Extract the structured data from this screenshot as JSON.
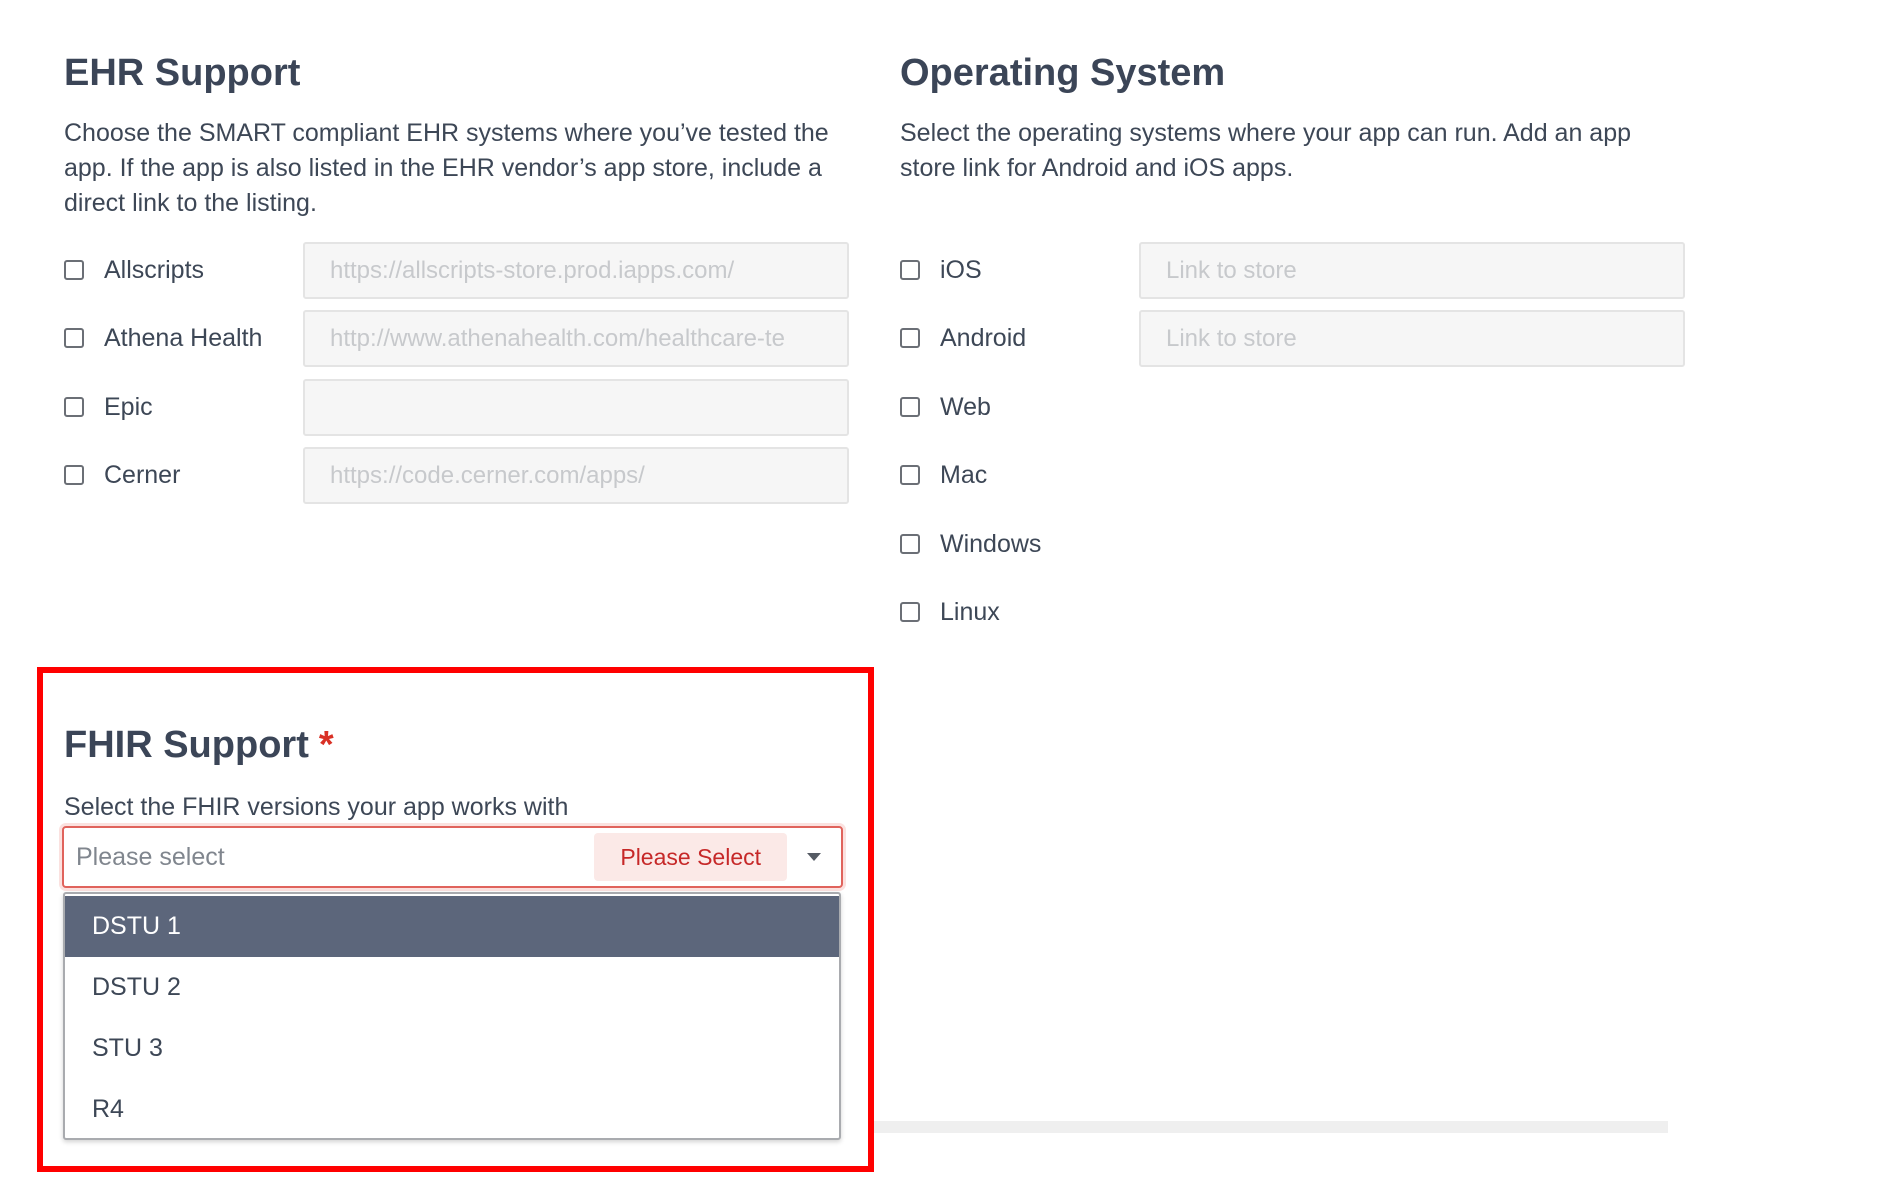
{
  "ehr": {
    "title": "EHR Support",
    "description": "Choose the SMART compliant EHR systems where you’ve tested the app. If the app is also listed in the EHR vendor’s app store, include a direct link to the listing.",
    "items": [
      {
        "label": "Allscripts",
        "placeholder": "https://allscripts-store.prod.iapps.com/"
      },
      {
        "label": "Athena Health",
        "placeholder": "http://www.athenahealth.com/healthcare-te"
      },
      {
        "label": "Epic",
        "placeholder": ""
      },
      {
        "label": "Cerner",
        "placeholder": "https://code.cerner.com/apps/"
      }
    ]
  },
  "os": {
    "title": "Operating System",
    "description": "Select the operating systems where your app can run. Add an app store link for Android and iOS apps.",
    "items": [
      {
        "label": "iOS",
        "placeholder": "Link to store"
      },
      {
        "label": "Android",
        "placeholder": "Link to store"
      },
      {
        "label": "Web"
      },
      {
        "label": "Mac"
      },
      {
        "label": "Windows"
      },
      {
        "label": "Linux"
      }
    ]
  },
  "fhir": {
    "title": "FHIR Support",
    "required_mark": "*",
    "description": "Select the FHIR versions your app works with",
    "select": {
      "placeholder": "Please select",
      "validation_tag": "Please Select",
      "caret_icon": "caret-down-icon"
    },
    "options": [
      {
        "label": "DSTU 1",
        "highlighted": true
      },
      {
        "label": "DSTU 2",
        "highlighted": false
      },
      {
        "label": "STU 3",
        "highlighted": false
      },
      {
        "label": "R4",
        "highlighted": false
      }
    ]
  },
  "colors": {
    "heading": "#3b4557",
    "text": "#3d4756",
    "highlight_border": "#ff0000",
    "error": "#c62828",
    "error_bg": "#fbe9e7",
    "option_active_bg": "#5c667b"
  }
}
